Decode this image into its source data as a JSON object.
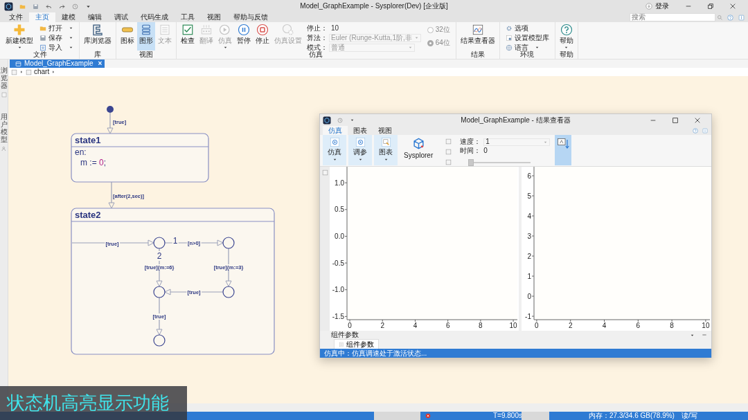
{
  "app": {
    "title": "Model_GraphExample - Sysplorer(Dev) [企业版]",
    "login": "登录"
  },
  "menu_tabs": [
    {
      "label": "文件",
      "selected": false
    },
    {
      "label": "主页",
      "selected": true
    },
    {
      "label": "建模",
      "selected": false
    },
    {
      "label": "编辑",
      "selected": false
    },
    {
      "label": "调试",
      "selected": false
    },
    {
      "label": "代码生成",
      "selected": false
    },
    {
      "label": "工具",
      "selected": false
    },
    {
      "label": "视图",
      "selected": false
    },
    {
      "label": "帮助与反馈",
      "selected": false
    }
  ],
  "search": {
    "placeholder": "搜索"
  },
  "ribbon": [
    {
      "label": "文件",
      "items": [
        {
          "kind": "large",
          "label": "新建模型",
          "dropdown": true,
          "disabled": false
        },
        {
          "kind": "small",
          "label": "打开",
          "dropdown": true
        },
        {
          "kind": "small",
          "label": "保存",
          "dropdown": true
        },
        {
          "kind": "small",
          "label": "导入",
          "dropdown": true
        }
      ]
    },
    {
      "label": "库",
      "items": [
        {
          "kind": "large",
          "label": "库浏览器",
          "dropdown": false,
          "disabled": false
        }
      ]
    },
    {
      "label": "视图",
      "items": [
        {
          "kind": "large",
          "label": "图标",
          "dropdown": false,
          "disabled": false,
          "selected": false
        },
        {
          "kind": "large",
          "label": "图形",
          "dropdown": false,
          "disabled": false,
          "selected": true
        },
        {
          "kind": "large",
          "label": "文本",
          "dropdown": false,
          "disabled": true,
          "selected": false
        }
      ]
    },
    {
      "label": "仿真",
      "items": [
        {
          "kind": "large",
          "label": "检查",
          "dropdown": false,
          "disabled": false
        },
        {
          "kind": "large",
          "label": "翻译",
          "dropdown": false,
          "disabled": true
        },
        {
          "kind": "large",
          "label": "仿真",
          "dropdown": true,
          "disabled": true
        },
        {
          "kind": "large",
          "label": "暂停",
          "dropdown": false,
          "disabled": false
        },
        {
          "kind": "large",
          "label": "停止",
          "dropdown": false,
          "disabled": false
        },
        {
          "kind": "large",
          "label": "仿真设置",
          "dropdown": false,
          "disabled": true
        }
      ],
      "fields": [
        {
          "kind": "field",
          "label": "停止：",
          "value": "10",
          "dropdown": false,
          "disabled": false
        },
        {
          "kind": "field",
          "label": "算法：",
          "value": "Euler (Runge-Kutta,1阶,非",
          "dropdown": true,
          "disabled": true
        },
        {
          "kind": "field",
          "label": "模式：",
          "value": "普通",
          "dropdown": true,
          "disabled": true
        }
      ],
      "options": [
        {
          "kind": "radio",
          "label": "32位",
          "selected": false
        },
        {
          "kind": "radio",
          "label": "64位",
          "selected": true
        }
      ]
    },
    {
      "label": "结果",
      "items": [
        {
          "kind": "large",
          "label": "结果查看器",
          "dropdown": false,
          "disabled": false
        }
      ]
    },
    {
      "label": "环境",
      "items": [
        {
          "kind": "small",
          "label": "选项",
          "dropdown": false
        },
        {
          "kind": "small",
          "label": "设置模型库",
          "dropdown": false
        },
        {
          "kind": "small",
          "label": "语言",
          "dropdown": true
        }
      ]
    },
    {
      "label": "帮助",
      "items": [
        {
          "kind": "large",
          "label": "帮助",
          "dropdown": true,
          "disabled": false
        }
      ]
    }
  ],
  "document_tab": {
    "label": "Model_GraphExample",
    "close": "×"
  },
  "breadcrumb": [
    "chart"
  ],
  "side_panels": [
    {
      "label": "浏览器"
    },
    {
      "label": "用户模型"
    }
  ],
  "state_chart": {
    "states": [
      {
        "name": "state1",
        "entry": {
          "label": "en:",
          "tokens": [
            {
              "kind": "code",
              "text": "m := "
            },
            {
              "kind": "number",
              "text": "0"
            },
            {
              "kind": "code",
              "text": ";"
            }
          ]
        }
      },
      {
        "name": "state2"
      }
    ],
    "transitions": [
      {
        "label": "[true]"
      },
      {
        "label": "[after(2,sec)]"
      },
      {
        "label": "[true]"
      },
      {
        "label": "[n>0]",
        "priority": "1"
      },
      {
        "label": "[true]{m:=3}"
      },
      {
        "label": "[true]{m:=6}",
        "priority": "2"
      },
      {
        "label": "[true]"
      },
      {
        "label": "[true]"
      }
    ]
  },
  "result_viewer": {
    "title": "Model_GraphExample - 结果查看器",
    "tabs": [
      {
        "label": "仿真",
        "selected": true
      },
      {
        "label": "图表",
        "selected": false
      },
      {
        "label": "视图",
        "selected": false
      }
    ],
    "toolbar": [
      {
        "kind": "menu",
        "label": "仿真"
      },
      {
        "kind": "menu",
        "label": "调参"
      },
      {
        "kind": "menu",
        "label": "图表"
      },
      {
        "kind": "brand",
        "label": "Sysplorer"
      }
    ],
    "speed": {
      "label": "速度：",
      "value": "1"
    },
    "time": {
      "label": "时间：",
      "value": "0",
      "level": 0
    },
    "plots": [
      {
        "chart_data": {
          "type": "line",
          "xlim": [
            -0.17,
            10.25
          ],
          "ylim": [
            -1.56,
            1.3
          ],
          "xticks": [
            0,
            2,
            4,
            6,
            8,
            10
          ],
          "yticks": [
            {
              "value": -1.5,
              "label": "-1.5"
            },
            {
              "value": -1,
              "label": "-1.0"
            },
            {
              "value": -0.5,
              "label": "-0.5"
            },
            {
              "value": 0,
              "label": "0.0"
            },
            {
              "value": 0.5,
              "label": "0.5"
            },
            {
              "value": 1,
              "label": "1.0"
            }
          ]
        }
      },
      {
        "chart_data": {
          "type": "line",
          "xlim": [
            -0.16,
            10.25
          ],
          "ylim": [
            -1.17,
            6.45
          ],
          "xticks": [
            0,
            2,
            4,
            6,
            8,
            10
          ],
          "yticks": [
            -1,
            0,
            1,
            2,
            3,
            4,
            5,
            6
          ]
        }
      }
    ],
    "panel": {
      "title": "组件参数",
      "tabs": [
        {
          "label": "组件参数",
          "selected": true
        }
      ]
    },
    "status": "仿真中：仿真调速处于激活状态..."
  },
  "status_bar": {
    "time": "T=9.800s",
    "memory": "内存：27.3/34.6 GB(78.9%)",
    "access": "读/写"
  },
  "caption": "状态机高亮显示功能"
}
